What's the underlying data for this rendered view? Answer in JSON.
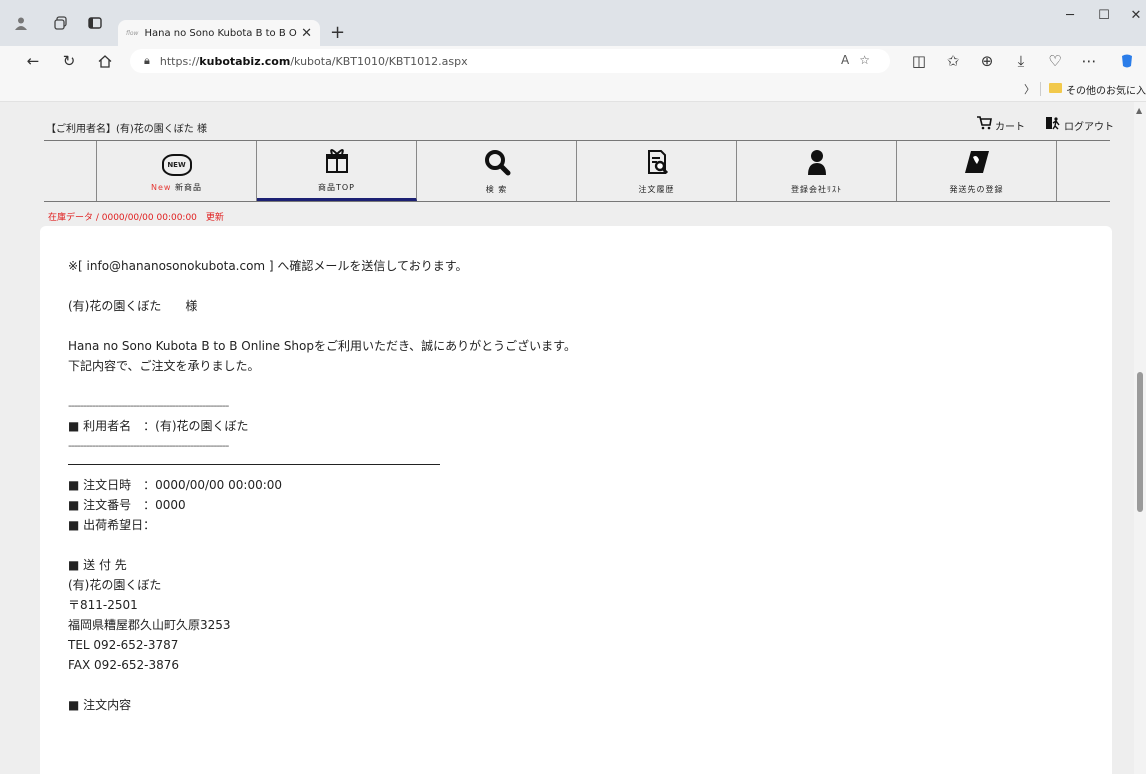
{
  "browser": {
    "tab_title": "Hana no Sono Kubota B to B Onl",
    "tab_favicon_text": "flow",
    "url_prefix": "https://",
    "url_host": "kubotabiz.com",
    "url_path": "/kubota/KBT1010/KBT1012.aspx",
    "favorites_folder": "その他のお気に入り"
  },
  "header": {
    "user_label": "【ご利用者名】(有)花の園くぼた 様",
    "cart_label": "カート",
    "logout_label": "ログアウト"
  },
  "menu": {
    "items": [
      {
        "prefix": "New",
        "label": "新商品",
        "icon": "new-badge-icon",
        "badge": "NEW"
      },
      {
        "label": "商品TOP",
        "icon": "gift-icon"
      },
      {
        "label": "検 索",
        "icon": "search-icon"
      },
      {
        "label": "注文履歴",
        "icon": "order-history-icon"
      },
      {
        "label": "登録会社ﾘｽﾄ",
        "icon": "person-icon"
      },
      {
        "label": "発送先の登録",
        "icon": "address-book-icon"
      }
    ]
  },
  "stock_status": "在庫データ / 0000/00/00 00:00:00　更新",
  "mail": {
    "notice": "※[ info@hananosonokubota.com ] へ確認メールを送信しております。",
    "recipient": "(有)花の園くぼた　　様",
    "thanks": "Hana no Sono Kubota B to B Online Shopをご利用いただき、誠にありがとうございます。",
    "accepted": "下記内容で、ご注文を承りました。",
    "dashes": "------------------------------------------------------",
    "user_line": "■ 利用者名　：(有)花の園くぼた",
    "order_date": "■ 注文日時　：0000/00/00 00:00:00",
    "order_number": "■ 注文番号　：0000",
    "ship_date": "■ 出荷希望日：",
    "ship_to_heading": "■ 送 付 先",
    "ship_name": "(有)花の園くぼた",
    "postal": "〒811-2501",
    "address": "福岡県糟屋郡久山町久原3253",
    "tel": "TEL 092-652-3787",
    "fax": "FAX 092-652-3876",
    "order_contents": "■ 注文内容"
  }
}
